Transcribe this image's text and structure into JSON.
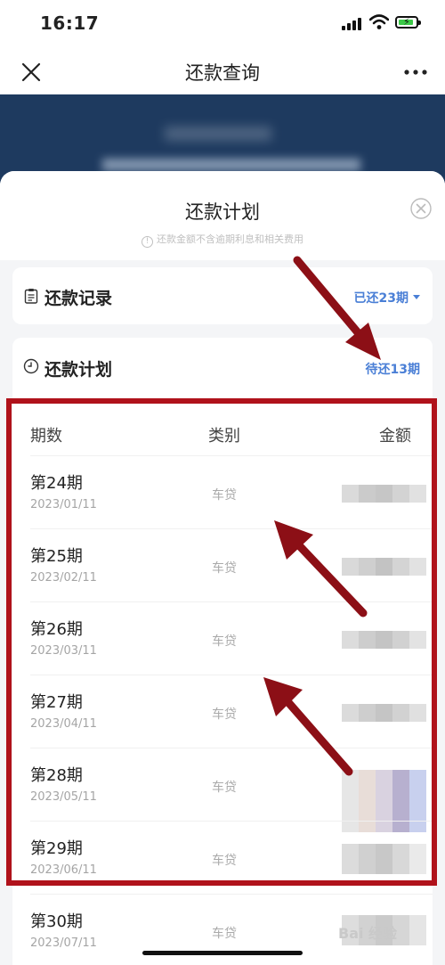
{
  "status_bar": {
    "time": "16:17"
  },
  "nav": {
    "title": "还款查询"
  },
  "sheet": {
    "title": "还款计划",
    "note": "还款金额不含逾期利息和相关费用",
    "note_icon": "info-icon"
  },
  "records": {
    "label": "还款记录",
    "paid": "已还23期",
    "icon": "clipboard-icon"
  },
  "plan": {
    "label": "还款计划",
    "pending": "待还13期",
    "icon": "clock-icon",
    "columns": [
      "期数",
      "类别",
      "金额"
    ],
    "rows": [
      {
        "period": "第24期",
        "date": "2023/01/11",
        "type": "车贷"
      },
      {
        "period": "第25期",
        "date": "2023/02/11",
        "type": "车贷"
      },
      {
        "period": "第26期",
        "date": "2023/03/11",
        "type": "车贷"
      },
      {
        "period": "第27期",
        "date": "2023/04/11",
        "type": "车贷"
      },
      {
        "period": "第28期",
        "date": "2023/05/11",
        "type": "车贷"
      },
      {
        "period": "第29期",
        "date": "2023/06/11",
        "type": "车贷"
      },
      {
        "period": "第30期",
        "date": "2023/07/11",
        "type": "车贷"
      }
    ]
  },
  "colors": {
    "accent": "#4a7fd6",
    "highlight": "#b0121b",
    "banner": "#1e3a5f"
  },
  "watermark": "Bai 经验"
}
